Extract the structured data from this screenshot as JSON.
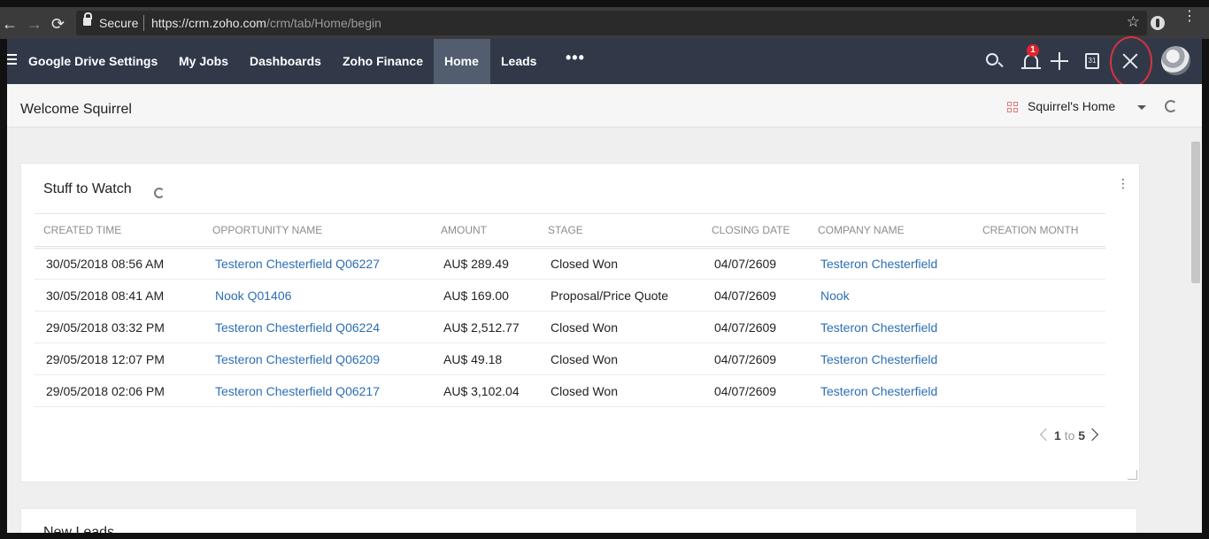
{
  "browser": {
    "secure_label": "Secure",
    "url_host": "https://crm.zoho.com",
    "url_path": "/crm/tab/Home/begin"
  },
  "nav": {
    "items": [
      {
        "label": "Google Drive Settings"
      },
      {
        "label": "My Jobs"
      },
      {
        "label": "Dashboards"
      },
      {
        "label": "Zoho Finance"
      },
      {
        "label": "Home"
      },
      {
        "label": "Leads"
      }
    ],
    "more_label": "•••",
    "notification_count": "1"
  },
  "header": {
    "welcome": "Welcome Squirrel",
    "home_selector": "Squirrel's Home"
  },
  "widget": {
    "title": "Stuff to Watch",
    "columns": [
      "CREATED TIME",
      "OPPORTUNITY NAME",
      "AMOUNT",
      "STAGE",
      "CLOSING DATE",
      "COMPANY NAME",
      "CREATION MONTH"
    ],
    "rows": [
      [
        "30/05/2018 08:56 AM",
        "Testeron Chesterfield Q06227",
        "AU$ 289.49",
        "Closed Won",
        "04/07/2609",
        "Testeron Chesterfield",
        ""
      ],
      [
        "30/05/2018 08:41 AM",
        "Nook Q01406",
        "AU$ 169.00",
        "Proposal/Price Quote",
        "04/07/2609",
        "Nook",
        ""
      ],
      [
        "29/05/2018 03:32 PM",
        "Testeron Chesterfield Q06224",
        "AU$ 2,512.77",
        "Closed Won",
        "04/07/2609",
        "Testeron Chesterfield",
        ""
      ],
      [
        "29/05/2018 12:07 PM",
        "Testeron Chesterfield Q06209",
        "AU$ 49.18",
        "Closed Won",
        "04/07/2609",
        "Testeron Chesterfield",
        ""
      ],
      [
        "29/05/2018 02:06 PM",
        "Testeron Chesterfield Q06217",
        "AU$ 3,102.04",
        "Closed Won",
        "04/07/2609",
        "Testeron Chesterfield",
        ""
      ]
    ],
    "pager": {
      "from": "1",
      "to_label": "to",
      "to": "5"
    }
  },
  "next_widget": {
    "title": "New Leads"
  },
  "colors": {
    "nav_bg": "#313949",
    "active_tab": "#535d70",
    "link": "#2c6eb5",
    "badge": "#e0232d",
    "highlight_circle": "#d9333c"
  }
}
